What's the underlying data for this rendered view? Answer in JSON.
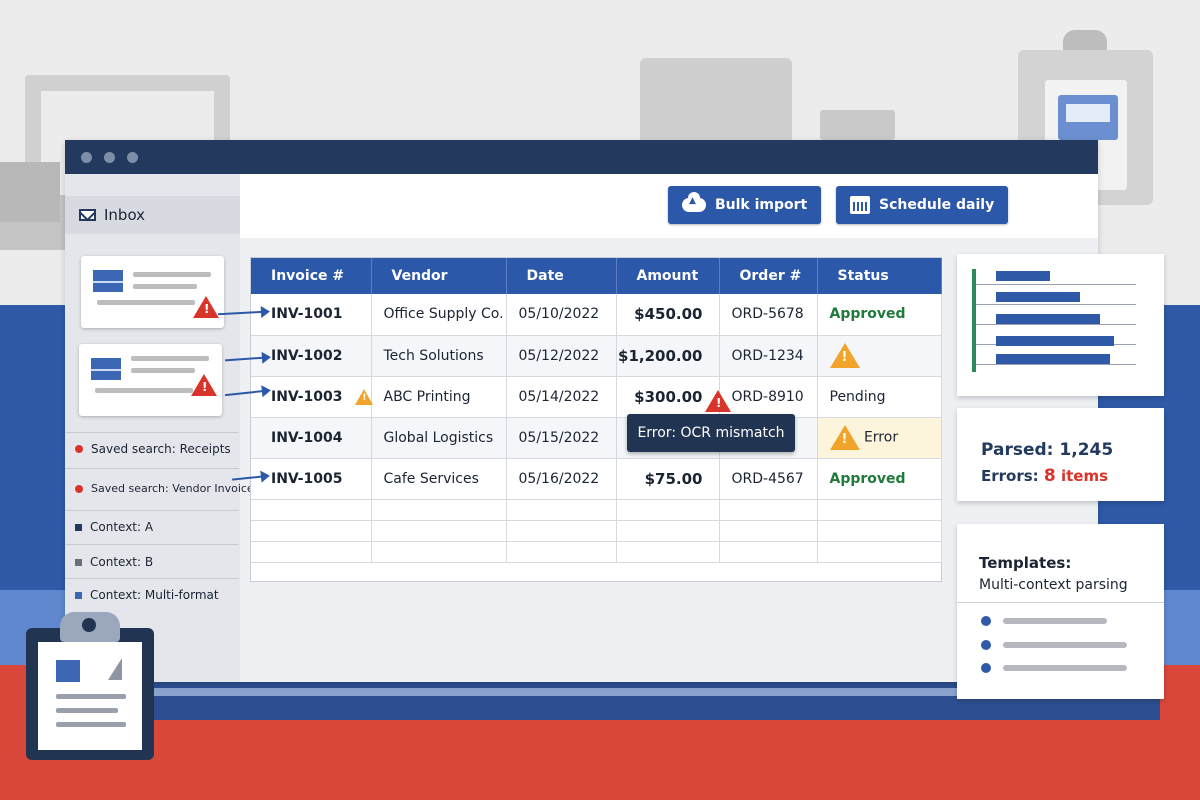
{
  "sidebar": {
    "inbox_label": "Inbox",
    "items": [
      {
        "label": "Saved search: Receipts",
        "marker": "dot-red"
      },
      {
        "label": "Saved search: Vendor Invoices",
        "marker": "dot-red"
      },
      {
        "label": "Context: A",
        "marker": "square-navy"
      },
      {
        "label": "Context: B",
        "marker": "square-gray"
      },
      {
        "label": "Context: Multi-format",
        "marker": "square-blue"
      }
    ]
  },
  "toolbar": {
    "bulk_import_label": "Bulk import",
    "schedule_daily_label": "Schedule daily",
    "bulk_import_icon": "cloud-upload-icon",
    "schedule_daily_icon": "calendar-icon"
  },
  "table": {
    "columns": [
      "Invoice #",
      "Vendor",
      "Date",
      "Amount",
      "Order #",
      "Status"
    ],
    "rows": [
      {
        "invoice": "INV-1001",
        "vendor": "Office Supply Co.",
        "date": "05/10/2022",
        "amount": "$450.00",
        "order": "ORD-5678",
        "status": "Approved"
      },
      {
        "invoice": "INV-1002",
        "vendor": "Tech Solutions",
        "date": "05/12/2022",
        "amount": "$1,200.00",
        "order": "ORD-1234",
        "status": ""
      },
      {
        "invoice": "INV-1003",
        "vendor": "ABC Printing",
        "date": "05/14/2022",
        "amount": "$300.00",
        "order": "ORD-8910",
        "status": "Pending"
      },
      {
        "invoice": "INV-1004",
        "vendor": "Global Logistics",
        "date": "05/15/2022",
        "amount": "",
        "order": "",
        "status": "Error"
      },
      {
        "invoice": "INV-1005",
        "vendor": "Cafe Services",
        "date": "05/16/2022",
        "amount": "$75.00",
        "order": "ORD-4567",
        "status": "Approved"
      }
    ]
  },
  "tooltip": {
    "text": "Error: OCR mismatch"
  },
  "stats": {
    "parsed_label": "Parsed:",
    "parsed_value": "1,245",
    "errors_label": "Errors:",
    "errors_count": "8",
    "errors_unit": "items"
  },
  "templates": {
    "title": "Templates:",
    "subtitle": "Multi-context parsing"
  },
  "colors": {
    "primary": "#2b58a8",
    "titlebar": "#233a5e",
    "approved": "#1f7a3c",
    "error": "#d9342b",
    "warning": "#f0a52a"
  }
}
